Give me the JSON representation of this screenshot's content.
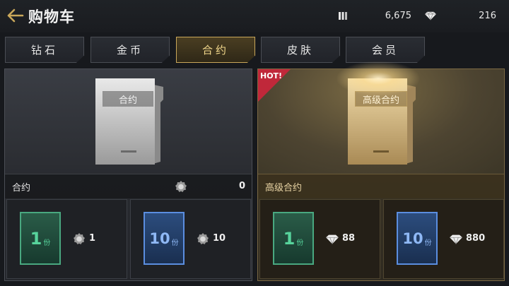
{
  "header": {
    "title": "购物车",
    "gold_value": "6,675",
    "diamond_value": "216"
  },
  "tabs": [
    {
      "label": "钻石",
      "active": false
    },
    {
      "label": "金币",
      "active": false
    },
    {
      "label": "合约",
      "active": true
    },
    {
      "label": "皮肤",
      "active": false
    },
    {
      "label": "会员",
      "active": false
    }
  ],
  "panels": [
    {
      "doc_label": "合约",
      "name": "合约",
      "owned": "0",
      "currency_icon": "medal-icon",
      "options": [
        {
          "qty": "1",
          "unit": "份",
          "price": "1",
          "card_color": "#49a880"
        },
        {
          "qty": "10",
          "unit": "份",
          "price": "10",
          "card_color": "#5b8ee0"
        }
      ]
    },
    {
      "doc_label": "高级合约",
      "name": "高级合约",
      "badge": "HOT!",
      "currency_icon": "diamond-icon",
      "options": [
        {
          "qty": "1",
          "unit": "份",
          "price": "88",
          "card_color": "#49a880"
        },
        {
          "qty": "10",
          "unit": "份",
          "price": "880",
          "card_color": "#5b8ee0"
        }
      ]
    }
  ],
  "colors": {
    "accent_gold": "#c9a75a",
    "hot_red": "#c0283a"
  }
}
